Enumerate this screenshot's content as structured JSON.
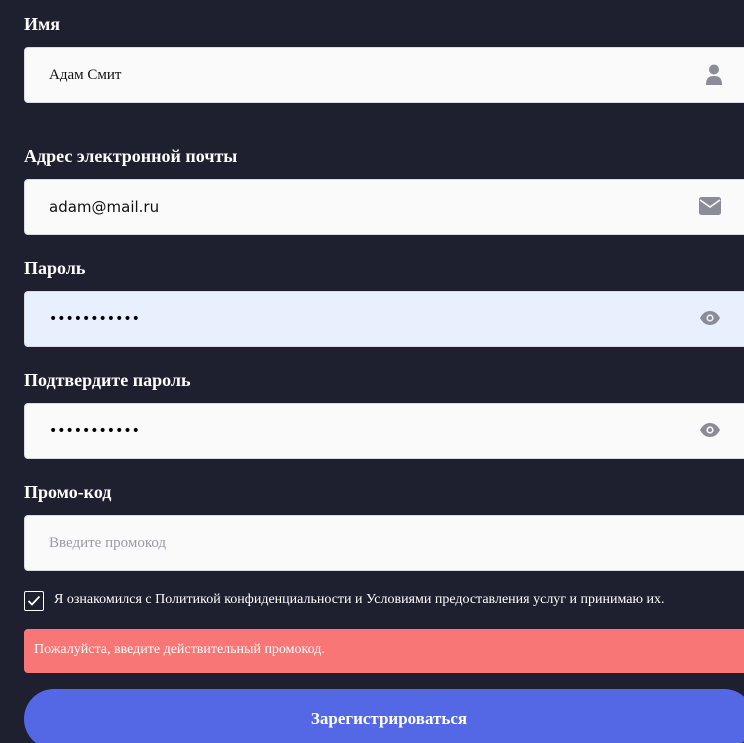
{
  "form": {
    "name": {
      "label": "Имя",
      "value": "Адам Смит",
      "icon": "user-icon"
    },
    "email": {
      "label": "Адрес электронной почты",
      "value": "adam@mail.ru",
      "icon": "envelope-icon"
    },
    "password": {
      "label": "Пароль",
      "value": "•••••••••••",
      "icon": "eye-icon"
    },
    "confirm_password": {
      "label": "Подтвердите пароль",
      "value": "•••••••••••",
      "icon": "eye-icon"
    },
    "promo": {
      "label": "Промо-код",
      "value": "",
      "placeholder": "Введите промокод"
    },
    "terms": {
      "checked": true,
      "text": "Я ознакомился с Политикой конфиденциальности и Условиями предоставления услуг и принимаю их."
    },
    "error_message": "Пожалуйста, введите действительный промокод.",
    "submit_label": "Зарегистрироваться"
  },
  "colors": {
    "background": "#1e1f2f",
    "field": "#fafafa",
    "field_autofill": "#e8f0fe",
    "icon": "#8a8d97",
    "error": "#f97676",
    "button": "#5468e6"
  }
}
